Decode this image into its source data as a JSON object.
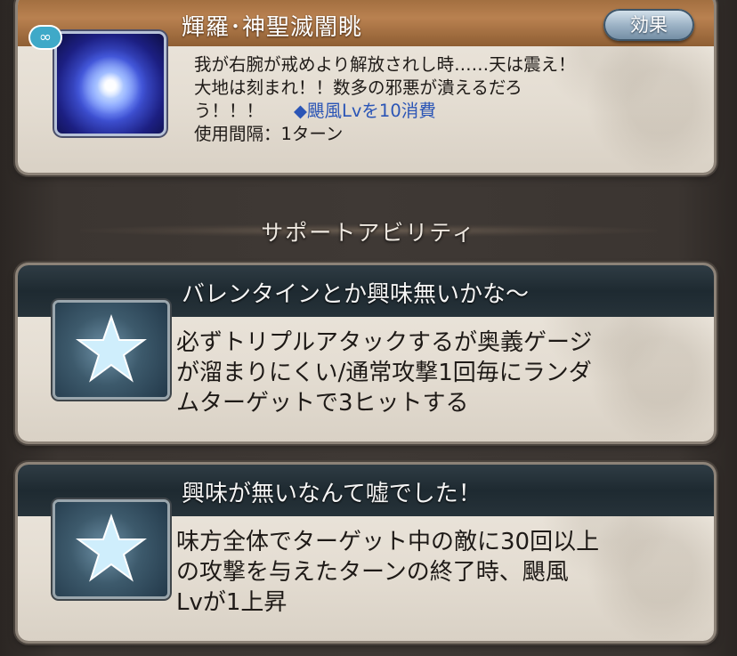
{
  "skill": {
    "title": "輝羅･神聖滅闇眺",
    "effect_button": "効果",
    "link_symbol": "∞",
    "description_lines": [
      "我が右腕が戒めより解放されし時……天は震え！",
      "大地は刻まれ！！数多の邪悪が潰えるだろ",
      "う！！！"
    ],
    "cost": "◆颶風Lvを10消費",
    "cooldown": "使用間隔：1ターン"
  },
  "section": {
    "label": "サポートアビリティ"
  },
  "support": [
    {
      "title": "バレンタインとか興味無いかな～",
      "description_lines": [
        "必ずトリプルアタックするが奥義ゲージ",
        "が溜まりにくい/通常攻撃1回毎にランダ",
        "ムターゲットで3ヒットする"
      ]
    },
    {
      "title": "興味が無いなんて嘘でした！",
      "description_lines": [
        "味方全体でターゲット中の敵に30回以上",
        "の攻撃を与えたターンの終了時、颶風",
        "Lvが1上昇"
      ]
    }
  ],
  "icons": {
    "skill_icon": "blue-energy-orb-icon",
    "link_icon": "link-icon",
    "support_icon": "star-icon"
  },
  "colors": {
    "skill_header": "#b98150",
    "support_header": "#1e2a31",
    "cost_text": "#2b55b6",
    "effect_button": "#9db3c6"
  }
}
